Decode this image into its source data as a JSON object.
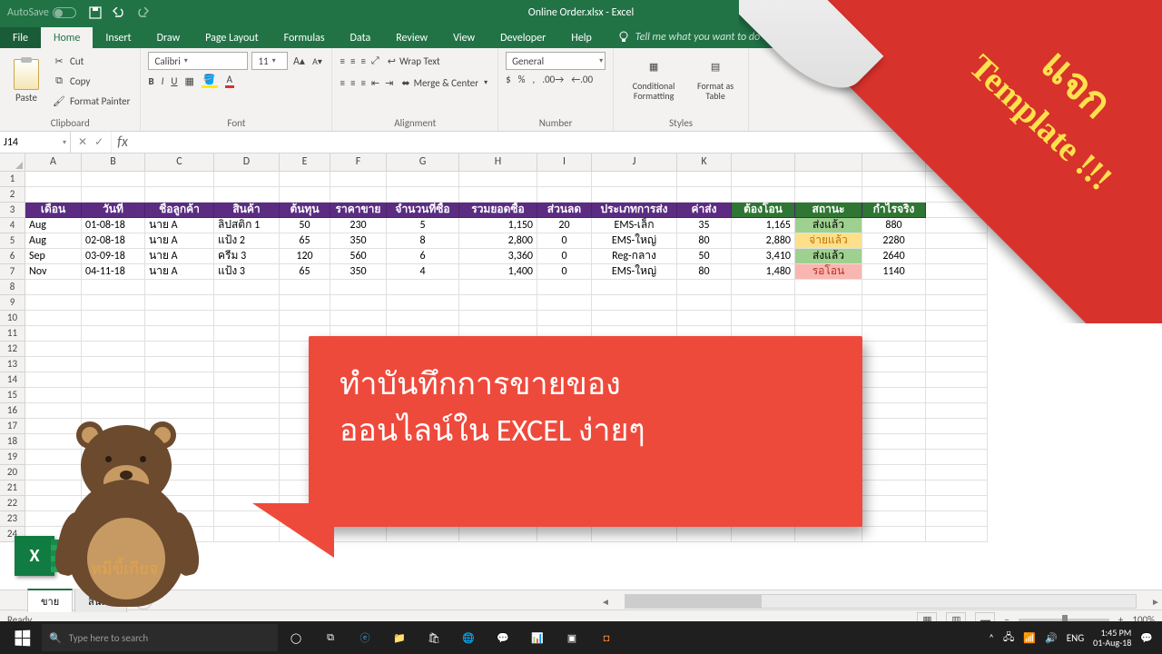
{
  "titlebar": {
    "autosave": "AutoSave",
    "title": "Online Order.xlsx - Excel"
  },
  "tabs": {
    "file": "File",
    "home": "Home",
    "insert": "Insert",
    "draw": "Draw",
    "pagelayout": "Page Layout",
    "formulas": "Formulas",
    "data": "Data",
    "review": "Review",
    "view": "View",
    "developer": "Developer",
    "help": "Help",
    "tell": "Tell me what you want to do"
  },
  "ribbon": {
    "clipboard": {
      "paste": "Paste",
      "cut": "Cut",
      "copy": "Copy",
      "painter": "Format Painter",
      "label": "Clipboard"
    },
    "font": {
      "name": "Calibri",
      "size": "11",
      "label": "Font"
    },
    "alignment": {
      "wrap": "Wrap Text",
      "merge": "Merge & Center",
      "label": "Alignment"
    },
    "number": {
      "format": "General",
      "label": "Number"
    },
    "styles": {
      "cond": "Conditional Formatting",
      "table": "Format as Table",
      "label": "Styles"
    }
  },
  "namebox": "J14",
  "fx": "fx",
  "columns": [
    "A",
    "B",
    "C",
    "D",
    "E",
    "F",
    "G",
    "H",
    "I",
    "J",
    "K",
    "",
    "",
    "",
    ""
  ],
  "headers1": [
    "เดือน",
    "วันที่",
    "ชื่อลูกค้า",
    "สินค้า",
    "ต้นทุน",
    "ราคาขาย",
    "จำนวนที่ซื้อ",
    "รวมยอดซื้อ",
    "ส่วนลด",
    "ประเภทการส่ง",
    "ค่าส่ง"
  ],
  "headers2": [
    "ต้องโอน",
    "สถานะ",
    "กำไรจริง"
  ],
  "data_rows": [
    {
      "m": "Aug",
      "d": "01-08-18",
      "cust": "นาย A",
      "prod": "ลิปสติก 1",
      "cost": "50",
      "price": "230",
      "qty": "5",
      "total": "1,150",
      "disc": "20",
      "ship": "EMS-เล็ก",
      "sc": "35",
      "pay": "1,165",
      "st": "ส่งแล้ว",
      "stc": "sent",
      "profit": "880"
    },
    {
      "m": "Aug",
      "d": "02-08-18",
      "cust": "นาย A",
      "prod": "แป้ง 2",
      "cost": "65",
      "price": "350",
      "qty": "8",
      "total": "2,800",
      "disc": "0",
      "ship": "EMS-ใหญ่",
      "sc": "80",
      "pay": "2,880",
      "st": "จ่ายแล้ว",
      "stc": "paid",
      "profit": "2280"
    },
    {
      "m": "Sep",
      "d": "03-09-18",
      "cust": "นาย A",
      "prod": "ครีม 3",
      "cost": "120",
      "price": "560",
      "qty": "6",
      "total": "3,360",
      "disc": "0",
      "ship": "Reg-กลาง",
      "sc": "50",
      "pay": "3,410",
      "st": "ส่งแล้ว",
      "stc": "sent",
      "profit": "2640"
    },
    {
      "m": "Nov",
      "d": "04-11-18",
      "cust": "นาย A",
      "prod": "แป้ง 3",
      "cost": "65",
      "price": "350",
      "qty": "4",
      "total": "1,400",
      "disc": "0",
      "ship": "EMS-ใหญ่",
      "sc": "80",
      "pay": "1,480",
      "st": "รอโอน",
      "stc": "wait",
      "profit": "1140"
    }
  ],
  "sheet": {
    "tab1": "ขาย",
    "tab2": "สินค้า"
  },
  "status": {
    "ready": "Ready",
    "zoom": "100%"
  },
  "taskbar": {
    "search": "Type here to search",
    "lang": "ENG",
    "time": "1:45 PM",
    "date": "01-Aug-18"
  },
  "overlay": {
    "speech_l1": "ทำบันทึกการขายของ",
    "speech_l2": "ออนไลน์ใน EXCEL ง่ายๆ",
    "fold_l1": "แจก",
    "fold_l2": "Template !!!",
    "bear": "หมีขี้เกียจ"
  }
}
